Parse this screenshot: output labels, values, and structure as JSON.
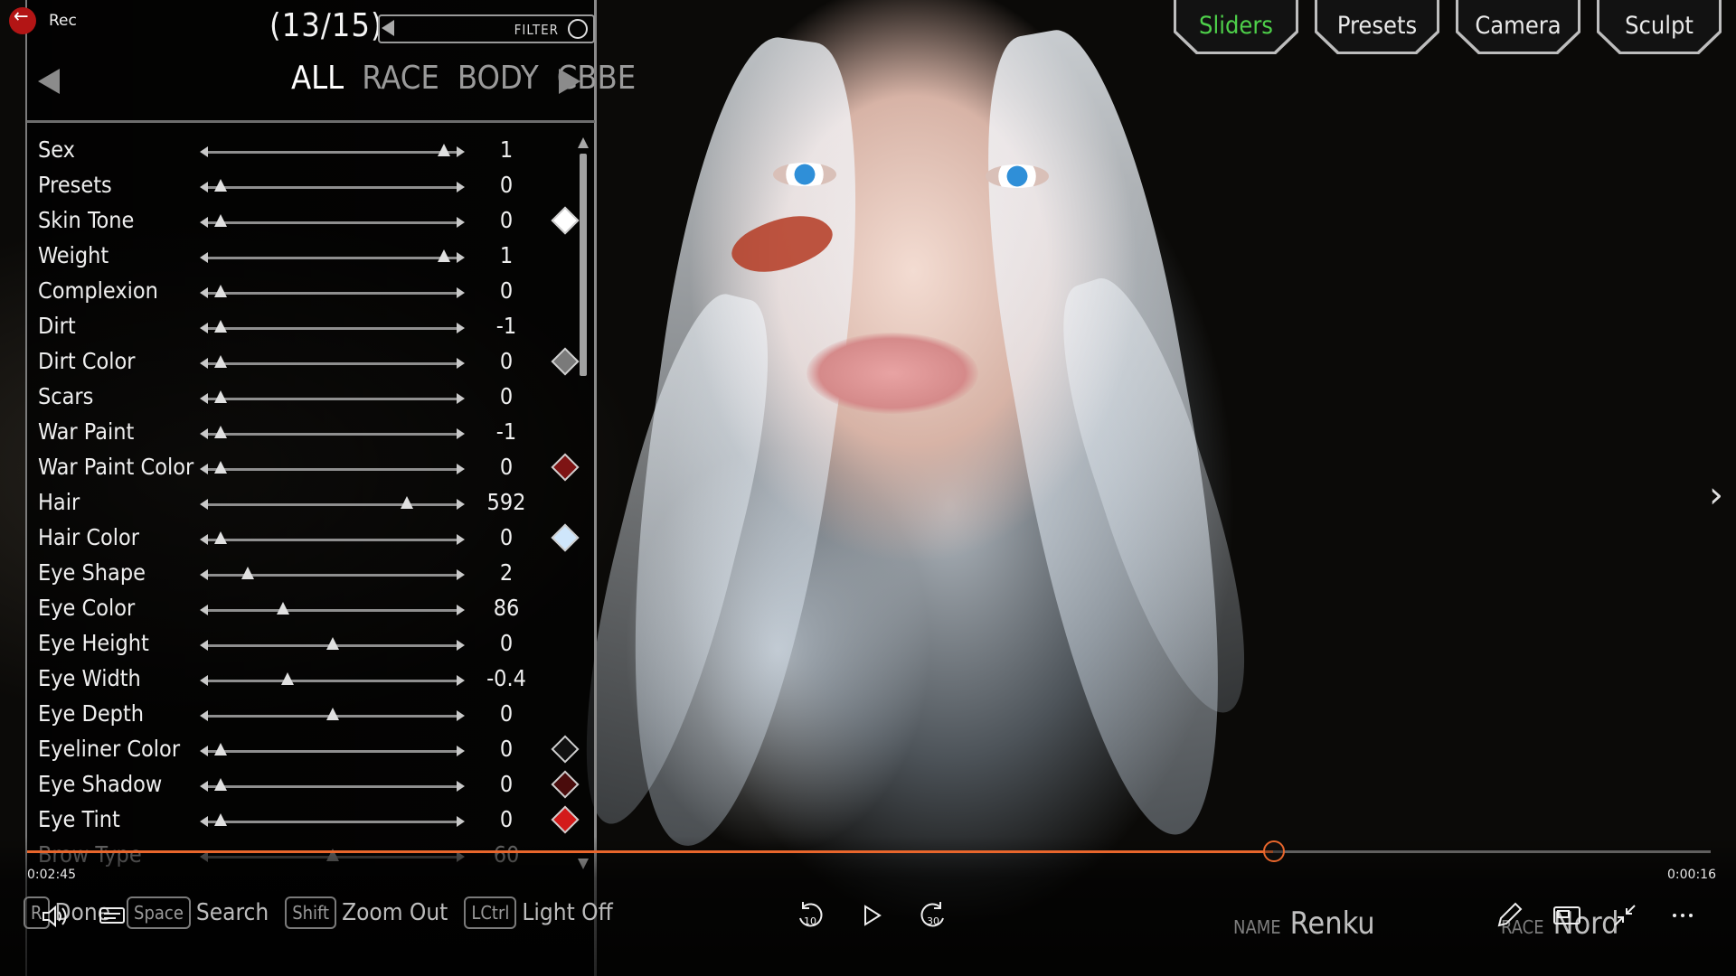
{
  "recording": {
    "label": "Rec"
  },
  "header": {
    "count": "(13/15)",
    "filter_label": "FILTER"
  },
  "category_tabs": [
    {
      "label": "ALL",
      "active": true
    },
    {
      "label": "RACE",
      "active": false
    },
    {
      "label": "BODY",
      "active": false
    },
    {
      "label": "CBBE",
      "active": false
    }
  ],
  "mode_tabs": [
    {
      "label": "Sliders",
      "active": true
    },
    {
      "label": "Presets",
      "active": false
    },
    {
      "label": "Camera",
      "active": false
    },
    {
      "label": "Sculpt",
      "active": false
    }
  ],
  "sliders": [
    {
      "label": "Sex",
      "value": "1",
      "fraction": 0.95,
      "swatch": null
    },
    {
      "label": "Presets",
      "value": "0",
      "fraction": 0.05,
      "swatch": null
    },
    {
      "label": "Skin Tone",
      "value": "0",
      "fraction": 0.05,
      "swatch": "#ffffff"
    },
    {
      "label": "Weight",
      "value": "1",
      "fraction": 0.95,
      "swatch": null
    },
    {
      "label": "Complexion",
      "value": "0",
      "fraction": 0.05,
      "swatch": null
    },
    {
      "label": "Dirt",
      "value": "-1",
      "fraction": 0.05,
      "swatch": null
    },
    {
      "label": "Dirt Color",
      "value": "0",
      "fraction": 0.05,
      "swatch": "#7a7a7a"
    },
    {
      "label": "Scars",
      "value": "0",
      "fraction": 0.05,
      "swatch": null
    },
    {
      "label": "War Paint",
      "value": "-1",
      "fraction": 0.05,
      "swatch": null
    },
    {
      "label": "War Paint Color",
      "value": "0",
      "fraction": 0.05,
      "swatch": "#7e1414"
    },
    {
      "label": "Hair",
      "value": "592",
      "fraction": 0.8,
      "swatch": null
    },
    {
      "label": "Hair Color",
      "value": "0",
      "fraction": 0.05,
      "swatch": "#cfe6fb"
    },
    {
      "label": "Eye Shape",
      "value": "2",
      "fraction": 0.16,
      "swatch": null
    },
    {
      "label": "Eye Color",
      "value": "86",
      "fraction": 0.3,
      "swatch": null
    },
    {
      "label": "Eye Height",
      "value": "0",
      "fraction": 0.5,
      "swatch": null
    },
    {
      "label": "Eye Width",
      "value": "-0.4",
      "fraction": 0.32,
      "swatch": null
    },
    {
      "label": "Eye Depth",
      "value": "0",
      "fraction": 0.5,
      "swatch": null
    },
    {
      "label": "Eyeliner Color",
      "value": "0",
      "fraction": 0.05,
      "swatch": "#111111"
    },
    {
      "label": "Eye Shadow",
      "value": "0",
      "fraction": 0.05,
      "swatch": "#4a0c0c"
    },
    {
      "label": "Eye Tint",
      "value": "0",
      "fraction": 0.05,
      "swatch": "#d31a1a"
    },
    {
      "label": "Brow Type",
      "value": "60",
      "fraction": 0.5,
      "swatch": null,
      "faded": true
    }
  ],
  "media": {
    "progress_fraction": 0.74,
    "time_elapsed": "0:02:45",
    "time_remaining": "0:00:16",
    "rewind_label": "10",
    "forward_label": "30"
  },
  "key_hints": [
    {
      "key": "R",
      "action": "Done"
    },
    {
      "key": "Space",
      "action": "Search"
    },
    {
      "key": "Shift",
      "action": "Zoom Out"
    },
    {
      "key": "LCtrl",
      "action": "Light Off"
    }
  ],
  "character": {
    "name_label": "NAME",
    "name": "Renku",
    "race_label": "RACE",
    "race": "Nord"
  },
  "colors": {
    "accent": "#e8662c",
    "active_tab": "#4ed04a"
  },
  "icons": [
    "back-arrow-icon",
    "filter-icon",
    "volume-icon",
    "captions-icon",
    "rewind-10-icon",
    "play-icon",
    "forward-30-icon",
    "edit-icon",
    "miniplayer-icon",
    "fullscreen-exit-icon",
    "more-icon",
    "chevron-right-icon"
  ]
}
